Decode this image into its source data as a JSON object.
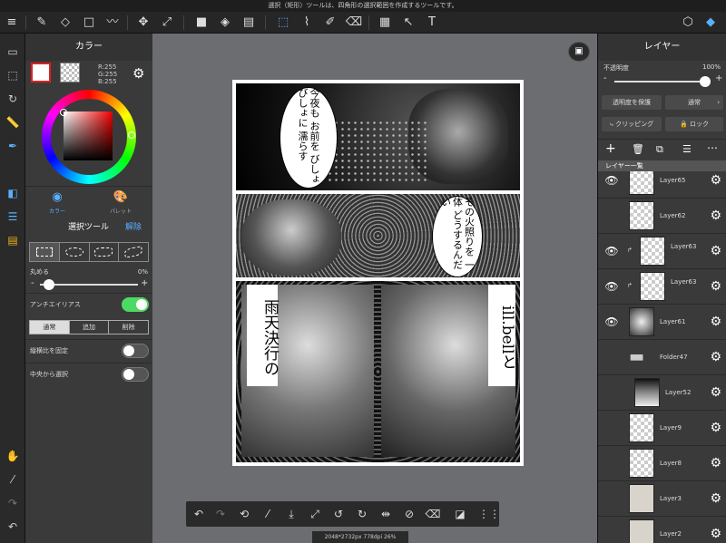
{
  "topbar": {
    "hint": "選択（矩形）ツールは、四角形の選択範囲を作成するツールです。"
  },
  "toolbar": {
    "menu": "≡",
    "text_tool": "T"
  },
  "color_panel": {
    "title": "カラー",
    "r": "R:255",
    "g": "G:255",
    "b": "B:255",
    "tab_color": "カラー",
    "tab_palette": "パレット",
    "accent": "#3a8fd6"
  },
  "select_tool": {
    "title": "選択ツール",
    "cancel": "解除",
    "round_label": "丸める",
    "round_value": "0%",
    "minus": "-",
    "plus": "+",
    "antialias": "アンチエイリアス",
    "mode_normal": "通常",
    "mode_add": "追加",
    "mode_delete": "削除",
    "fix_ratio": "縦横比を固定",
    "from_center": "中央から選択"
  },
  "layer_panel": {
    "title": "レイヤー",
    "opacity_label": "不透明度",
    "opacity_value": "100%",
    "minus": "-",
    "plus": "+",
    "protect_alpha": "透明度を保護",
    "blend_mode": "通常",
    "clipping": "クリッピング",
    "lock": "ロック",
    "list_header": "レイヤー一覧",
    "layers": [
      {
        "name": "Layer65",
        "visible": true
      },
      {
        "name": "Layer62",
        "visible": false
      },
      {
        "name": "Layer63",
        "visible": true,
        "clip": true
      },
      {
        "name": "Layer63",
        "visible": true,
        "clip": true
      },
      {
        "name": "Layer61",
        "visible": true
      },
      {
        "name": "Folder47",
        "visible": false
      },
      {
        "name": "Layer52",
        "visible": false
      },
      {
        "name": "Layer9",
        "visible": false
      },
      {
        "name": "Layer8",
        "visible": false
      },
      {
        "name": "Layer3",
        "visible": false
      },
      {
        "name": "Layer2",
        "visible": false
      }
    ]
  },
  "manga": {
    "bubble1": "今夜も お前を びしょびしょに 濡らす",
    "bubble2": "その火照りを 一体 どうするんだい",
    "box_left": "雨天決行の",
    "box_right": "ill.bellと"
  },
  "status": {
    "text": "2048*2732px 778dpi 26%"
  }
}
